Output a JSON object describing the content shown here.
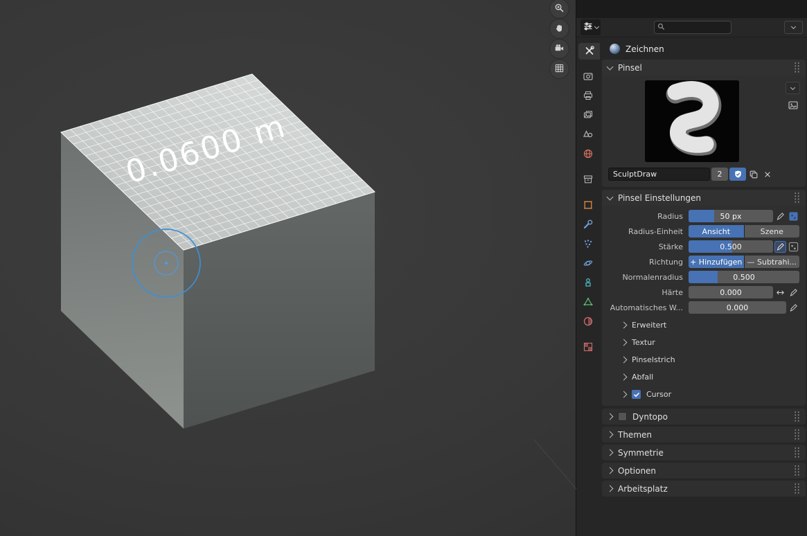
{
  "colors": {
    "accent": "#4772b3",
    "viewport_bg": "#383838",
    "panel_bg": "#2f2f2f"
  },
  "viewport": {
    "measurement_label": "0.0600 m",
    "nav": [
      "zoom",
      "pan-hand",
      "camera-view",
      "toggle-ortho-grid"
    ]
  },
  "properties": {
    "header": {
      "search_value": ""
    },
    "tabs": [
      "tool",
      "render",
      "output",
      "view-layer",
      "scene",
      "world",
      "collection",
      "object",
      "modifiers",
      "particles",
      "physics",
      "constraints",
      "object-data",
      "material",
      "texture"
    ],
    "active_tab": "tool",
    "tool_name": "Zeichnen",
    "brush_panel": {
      "title": "Pinsel",
      "brush_name": "SculptDraw",
      "user_count": "2"
    },
    "settings_panel": {
      "title": "Pinsel Einstellungen",
      "radius": {
        "label": "Radius",
        "value": "50 px",
        "fill_percent": 30
      },
      "radius_unit": {
        "label": "Radius-Einheit",
        "options": [
          "Ansicht",
          "Szene"
        ],
        "selected": "Ansicht"
      },
      "strength": {
        "label": "Stärke",
        "value": "0.500",
        "fill_percent": 52
      },
      "direction": {
        "label": "Richtung",
        "options": [
          {
            "sign": "+",
            "label": "Hinzufügen"
          },
          {
            "sign": "—",
            "label": "Subtrahi..."
          }
        ],
        "selected": "Hinzufügen"
      },
      "normal_radius": {
        "label": "Normalenradius",
        "value": "0.500",
        "fill_percent": 26
      },
      "hardness": {
        "label": "Härte",
        "value": "0.000",
        "fill_percent": 0
      },
      "auto_smoothing": {
        "label": "Automatisches W...",
        "value": "0.000",
        "fill_percent": 0
      },
      "subpanels": [
        {
          "label": "Erweitert"
        },
        {
          "label": "Textur"
        },
        {
          "label": "Pinselstrich"
        },
        {
          "label": "Abfall"
        }
      ],
      "cursor": {
        "label": "Cursor",
        "checked": true
      }
    },
    "collapsed_panels": [
      {
        "title": "Dyntopo",
        "has_checkbox": true,
        "checked": false
      },
      {
        "title": "Themen"
      },
      {
        "title": "Symmetrie"
      },
      {
        "title": "Optionen"
      },
      {
        "title": "Arbeitsplatz"
      }
    ]
  }
}
